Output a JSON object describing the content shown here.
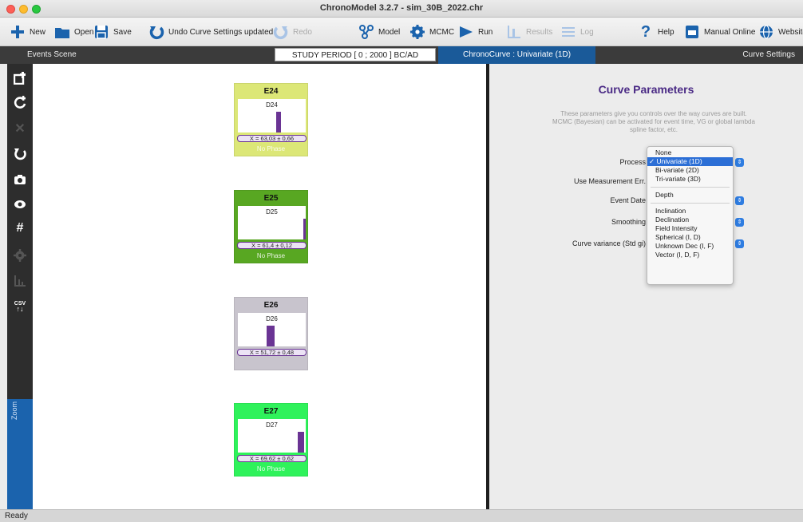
{
  "window": {
    "title": "ChronoModel 3.2.7 - sim_30B_2022.chr"
  },
  "toolbar": {
    "new": "New",
    "open": "Open",
    "save": "Save",
    "undo": "Undo Curve Settings updated",
    "redo": "Redo",
    "model": "Model",
    "mcmc": "MCMC",
    "run": "Run",
    "results": "Results",
    "log": "Log",
    "help": "Help",
    "manual": "Manual Online",
    "website": "Website"
  },
  "band": {
    "events_scene": "Events Scene",
    "study_period": "STUDY PERIOD [ 0 ; 2000 ] BC/AD",
    "chronocurve": "ChronoCurve : Univariate (1D)",
    "curve_settings": "Curve Settings"
  },
  "events": [
    {
      "name": "E24",
      "data_name": "D24",
      "x_label": "X = 63,03 ± 0,66",
      "phase": "No Phase",
      "color": "#dce777",
      "bar_center": 0.6,
      "bar_width": 0.07
    },
    {
      "name": "E25",
      "data_name": "D25",
      "x_label": "X = 61,4 ± 0,12",
      "phase": "No Phase",
      "color": "#58a722",
      "bar_center": 0.98,
      "bar_width": 0.03
    },
    {
      "name": "E26",
      "data_name": "D26",
      "x_label": "X = 51,72 ± 0,48",
      "phase": "",
      "color": "#c8c4cd",
      "bar_center": 0.48,
      "bar_width": 0.12
    },
    {
      "name": "E27",
      "data_name": "D27",
      "x_label": "X = 69,62 ± 0,62",
      "phase": "No Phase",
      "color": "#2ff25b",
      "bar_center": 0.93,
      "bar_width": 0.09
    }
  ],
  "panel": {
    "title": "Curve Parameters",
    "description": "These parameters give you controls over the way curves are built. MCMC (Bayesian) can be activated for event time, VG or global lambda spline factor, etc.",
    "labels": {
      "process": "Process",
      "use_measurement": "Use Measurement Err.",
      "event_date": "Event Date",
      "smoothing": "Smoothing",
      "curve_variance": "Curve variance (Std gi)"
    }
  },
  "process_menu": {
    "selected": "Univariate (1D)",
    "check": "✓",
    "items": {
      "none": "None",
      "univariate": "Univariate (1D)",
      "bivariate": "Bi-variate (2D)",
      "trivariate": "Tri-variate (3D)",
      "depth": "Depth",
      "inclination": "Inclination",
      "declination": "Declination",
      "field_intensity": "Field Intensity",
      "spherical": "Spherical (I, D)",
      "unknown_dec": "Unknown Dec (I, F)",
      "vector": "Vector (I, D, F)"
    }
  },
  "sidebar": {
    "zoom_label": "Zoom",
    "csv": "CSV"
  },
  "status": {
    "text": "Ready"
  },
  "colors": {
    "accent": "#2c6fd6",
    "title": "#4a2a85",
    "bar": "#6a3494"
  }
}
